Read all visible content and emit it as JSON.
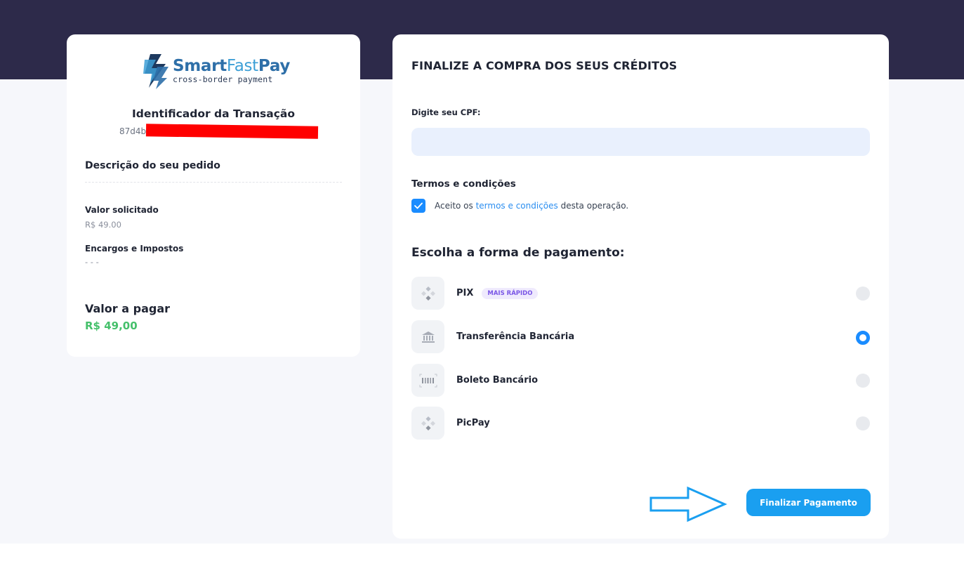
{
  "brand": {
    "name_part1": "Smart",
    "name_part2": "Fast",
    "name_part3": "Pay",
    "tagline": "cross-border payment",
    "colors": {
      "primary": "#2e6fa8",
      "secondary": "#3d9fd6"
    }
  },
  "order_summary": {
    "transaction_title": "Identificador da Transação",
    "transaction_id_visible": "87d4b",
    "description_title": "Descrição do seu pedido",
    "requested_label": "Valor solicitado",
    "requested_value": "R$ 49.00",
    "fees_label": "Encargos e Impostos",
    "fees_value": "- - -",
    "total_label": "Valor a pagar",
    "total_value": "R$ 49,00"
  },
  "checkout": {
    "title": "FINALIZE A COMPRA DOS SEUS CRÉDITOS",
    "cpf_label": "Digite seu CPF:",
    "cpf_value": "",
    "terms_title": "Termos e condições",
    "terms_checked": true,
    "terms_prefix": "Aceito os ",
    "terms_link": "termos e condições",
    "terms_suffix": " desta operação.",
    "payment_title": "Escolha a forma de pagamento:",
    "methods": [
      {
        "label": "PIX",
        "badge": "MAIS RÁPIDO",
        "icon": "pix-icon",
        "selected": false
      },
      {
        "label": "Transferência Bancária",
        "icon": "bank-icon",
        "selected": true
      },
      {
        "label": "Boleto Bancário",
        "icon": "barcode-icon",
        "selected": false
      },
      {
        "label": "PicPay",
        "icon": "picpay-icon",
        "selected": false
      }
    ],
    "submit_label": "Finalizar Pagamento"
  },
  "colors": {
    "header_band": "#2d2a4a",
    "accent_blue": "#1a8cff",
    "button_blue": "#1a9ff0",
    "total_green": "#45c06b",
    "input_bg": "#e9f0fd",
    "badge_purple": "#7a56e6"
  }
}
